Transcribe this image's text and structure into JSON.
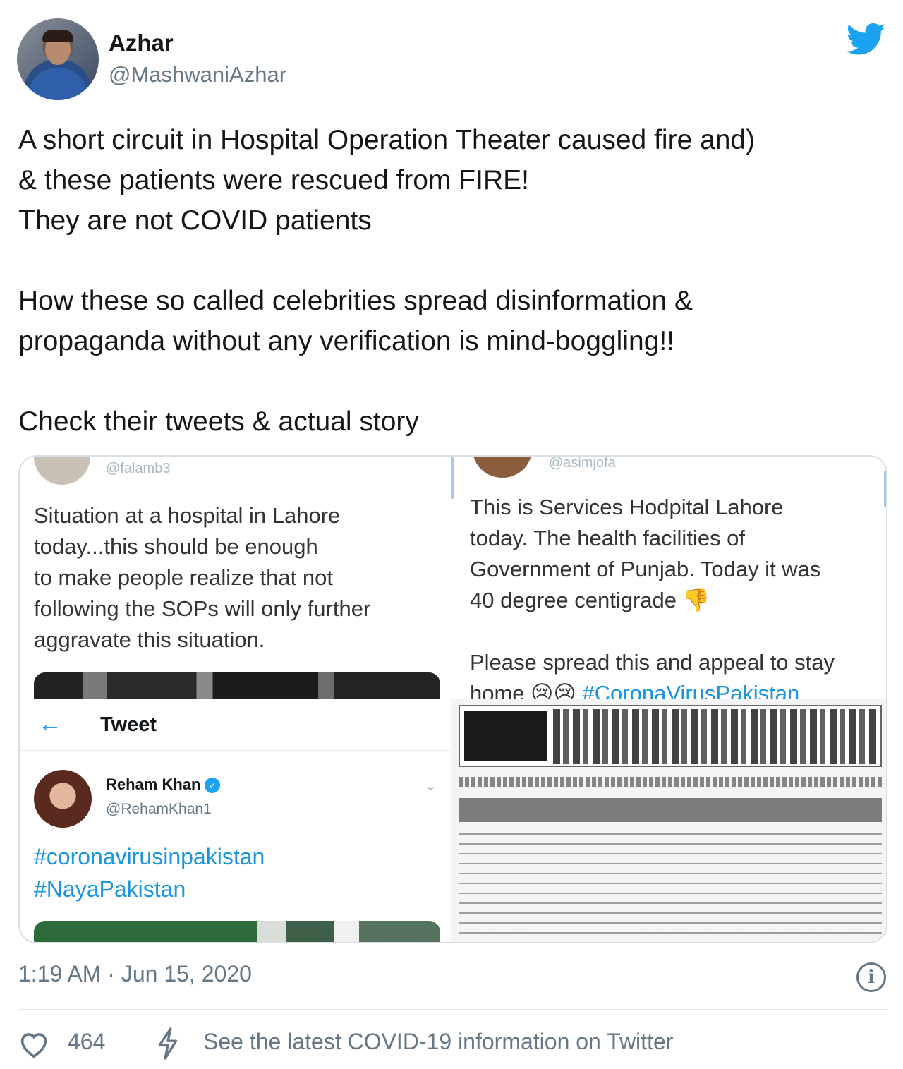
{
  "author": {
    "display_name": "Azhar",
    "handle": "@MashwaniAzhar"
  },
  "tweet": {
    "text": "A short circuit in Hospital Operation Theater caused fire and)\n& these patients were rescued from FIRE!\nThey are not COVID patients\n\nHow these so called celebrities spread disinformation &\npropaganda without any verification is mind-boggling!!\n\nCheck their tweets & actual story",
    "timestamp": "1:19 AM · Jun 15, 2020"
  },
  "media": {
    "top_left": {
      "handle": "@falamb3",
      "text": "Situation at a hospital in Lahore\ntoday...this should be enough\nto make people realize that not\nfollowing the SOPs will only further\naggravate this situation."
    },
    "top_right": {
      "handle": "@asimjofa",
      "text": "This is Services Hodpital Lahore\ntoday. The health facilities of\nGovernment of Punjab. Today it was\n40 degree centigrade 👎\n\nPlease spread this and appeal to stay\nhome 😢😢 ",
      "hashtag": "#CoronaVirusPakistan"
    },
    "bottom_left": {
      "nav_title": "Tweet",
      "name": "Reham Khan",
      "handle": "@RehamKhan1",
      "hashtags": "#coronavirusinpakistan\n#NayaPakistan"
    }
  },
  "footer": {
    "likes": "464",
    "covid_link": "See the latest COVID-19 information on Twitter"
  },
  "colors": {
    "twitter_blue": "#1da1f2",
    "secondary_text": "#657786"
  },
  "icons": [
    "twitter-bird-icon",
    "info-icon",
    "heart-icon",
    "bolt-icon",
    "back-arrow-icon",
    "verified-icon"
  ]
}
